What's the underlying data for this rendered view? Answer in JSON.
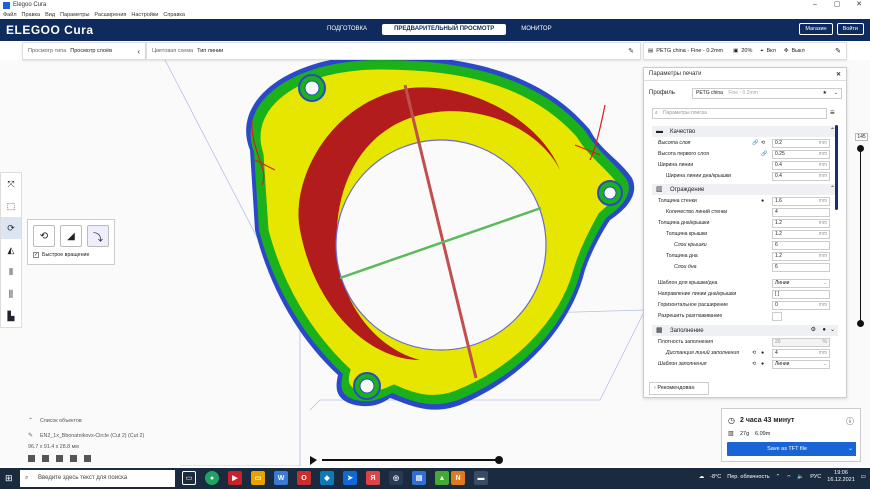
{
  "window": {
    "title": "Elegoo Cura"
  },
  "menu": [
    "Файл",
    "Правка",
    "Вид",
    "Параметры",
    "Расширения",
    "Настройки",
    "Справка"
  ],
  "header": {
    "logo": "ELEGOO Cura",
    "tabs": [
      {
        "label": "ПОДГОТОВКА",
        "active": false
      },
      {
        "label": "ПРЕДВАРИТЕЛЬНЫЙ ПРОСМОТР",
        "active": true
      },
      {
        "label": "МОНИТОР",
        "active": false
      }
    ],
    "shop_label": "Магазин",
    "signin_label": "Войти"
  },
  "viewbar": {
    "view_type_label": "Просмотр типа",
    "view_type_value": "Просмотр слоёв",
    "color_scheme_label": "Цветовая схема",
    "color_scheme_value": "Тип линии"
  },
  "printbar": {
    "profile": "PETG china - Fine - 0.2mm",
    "infill": "20%",
    "support": "Вкл",
    "adhesion": "Выкл"
  },
  "rotate_panel": {
    "snap_label": "Быстрое вращение"
  },
  "settings_panel": {
    "title": "Параметры печати",
    "profile_label": "Профиль",
    "profile_value": "PETG china",
    "profile_hint": "Fine - 0.2mm",
    "search_placeholder": "Параметры поиска",
    "recommended_label": "Рекомендован",
    "categories": [
      {
        "name": "Качество",
        "icon": "quality-icon"
      },
      {
        "name": "Ограждение",
        "icon": "walls-icon"
      },
      {
        "name": "Заполнение",
        "icon": "infill-icon"
      }
    ],
    "rows": [
      {
        "label": "Высота слоя",
        "value": "0.2",
        "unit": "mm",
        "italic": true
      },
      {
        "label": "Высота первого слоя",
        "value": "0.25",
        "unit": "mm",
        "italic": false
      },
      {
        "label": "Ширина линии",
        "value": "0.4",
        "unit": "mm",
        "italic": false
      },
      {
        "label": "Ширина линии дна/крышки",
        "value": "0.4",
        "unit": "mm",
        "italic": false
      },
      {
        "label": "Толщина стенки",
        "value": "1.6",
        "unit": "mm",
        "italic": false
      },
      {
        "label": "Количество линий стенки",
        "value": "4",
        "unit": "",
        "italic": false
      },
      {
        "label": "Толщина дна/крышки",
        "value": "1.2",
        "unit": "mm",
        "italic": false
      },
      {
        "label": "Толщина крышки",
        "value": "1.2",
        "unit": "mm",
        "italic": false
      },
      {
        "label": "Слои крышки",
        "value": "6",
        "unit": "",
        "italic": true
      },
      {
        "label": "Толщина дна",
        "value": "1.2",
        "unit": "mm",
        "italic": false
      },
      {
        "label": "Слои дна",
        "value": "6",
        "unit": "",
        "italic": true
      },
      {
        "label": "Шаблон для крышки/дна",
        "value": "Линии",
        "unit": "",
        "italic": false
      },
      {
        "label": "Направление линии дна/крышки",
        "value": "[ ]",
        "unit": "",
        "italic": false
      },
      {
        "label": "Горизонтальное расширение",
        "value": "0",
        "unit": "mm",
        "italic": false
      },
      {
        "label": "Разрешить разглаживание",
        "value": "",
        "unit": "",
        "italic": false
      },
      {
        "label": "Плотность заполнения",
        "value": "20",
        "unit": "%",
        "italic": false
      },
      {
        "label": "Дистанция линий заполнения",
        "value": "4",
        "unit": "mm",
        "italic": true
      },
      {
        "label": "Шаблон заполнения",
        "value": "Линии",
        "unit": "",
        "italic": true
      }
    ]
  },
  "layer_slider": {
    "value": "145"
  },
  "object_list": {
    "title": "Список объектов",
    "file": "EN2_1x_Bbonatnikovs-Circle (Cut 2) (Cut 2)",
    "dims": "96.7 x 91.4 x 28.8 мм"
  },
  "print_info": {
    "time": "2 часа 43 минут",
    "weight": "27g",
    "length": "6.09m",
    "save_label": "Save as TFT file"
  },
  "taskbar": {
    "search_placeholder": "Введите здесь текст для поиска",
    "weather": "-8°C",
    "weather_text": "Пер. облачность",
    "lang": "РУС",
    "time": "19:06",
    "date": "16.12.2021"
  },
  "colors": {
    "header": "#0f2a5c",
    "accent": "#1965d6",
    "wall_outer": "#e01a1a",
    "wall_inner": "#1bb11b",
    "skin": "#e6e600",
    "infill": "#b31c1c",
    "support": "#2a49c9"
  }
}
